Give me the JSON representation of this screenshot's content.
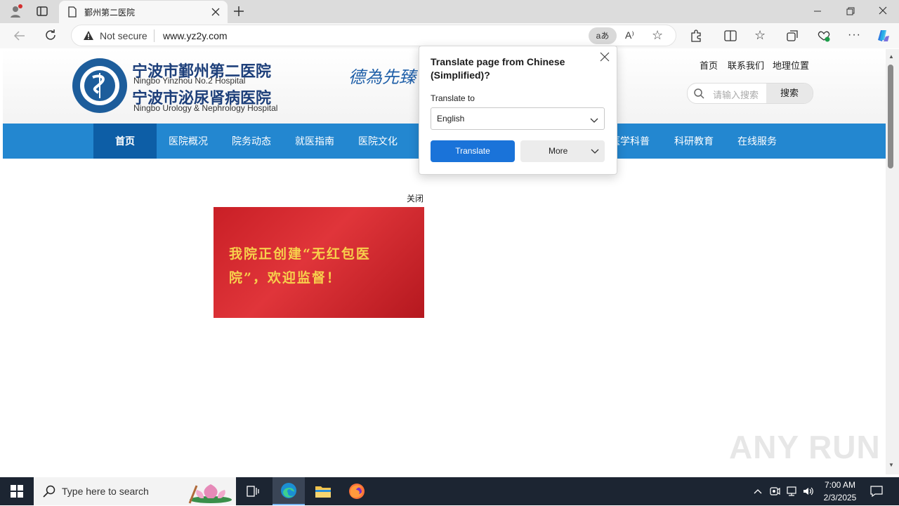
{
  "browser": {
    "tab_title": "鄞州第二医院",
    "security_label": "Not secure",
    "url": "www.yz2y.com"
  },
  "site": {
    "name_cn_1": "宁波市鄞州第二医院",
    "name_en_1": "Ningbo Yinzhou No.2 Hospital",
    "name_cn_2": "宁波市泌尿肾病医院",
    "name_en_2": "Ningbo Urology & Nephrology Hospital",
    "motto": "德為先臻",
    "top_links": [
      "首页",
      "联系我们",
      "地理位置"
    ],
    "search_placeholder": "请输入搜索",
    "search_button": "搜索",
    "nav": [
      "首页",
      "医院概况",
      "院务动态",
      "就医指南",
      "医院文化",
      "",
      "",
      "医学科普",
      "科研教育",
      "在线服务"
    ],
    "banner_close": "关闭",
    "banner_text_1": "我院正创建“无红包医",
    "banner_text_2": "院”，欢迎监督！"
  },
  "translate_popup": {
    "title": "Translate page from Chinese (Simplified)?",
    "translate_to_label": "Translate to",
    "language": "English",
    "translate_button": "Translate",
    "more_button": "More"
  },
  "taskbar": {
    "search_placeholder": "Type here to search",
    "time": "7:00 AM",
    "date": "2/3/2025"
  },
  "watermark": "ANY RUN"
}
